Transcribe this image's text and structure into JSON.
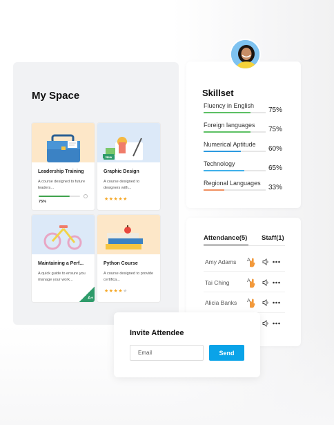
{
  "my_space": {
    "title": "My Space",
    "courses": [
      {
        "title": "Leadership Training",
        "desc": "A course designed to future leaders...",
        "progress_label": "75%",
        "progress": 0.75
      },
      {
        "title": "Graphic Design",
        "desc": "A course designed to designers with...",
        "rating": 4.5,
        "badge": "New"
      },
      {
        "title": "Maintaining a Perf...",
        "desc": "A quick guide to ensure you manage your work...",
        "badge": "A+"
      },
      {
        "title": "Python Course",
        "desc": "A course designed to provide certifica...",
        "rating": 4
      }
    ]
  },
  "skillset": {
    "title": "Skillset",
    "items": [
      {
        "name": "Fluency in English",
        "pct": "75%",
        "value": 0.75,
        "color": "#5cc063"
      },
      {
        "name": "Foreign languages",
        "pct": "75%",
        "value": 0.75,
        "color": "#5cc063"
      },
      {
        "name": "Numerical Aptitude",
        "pct": "60%",
        "value": 0.6,
        "color": "#2d9be0"
      },
      {
        "name": "Technology",
        "pct": "65%",
        "value": 0.65,
        "color": "#3fb0ea"
      },
      {
        "name": "Regional Languages",
        "pct": "33%",
        "value": 0.33,
        "color": "#f09060"
      }
    ]
  },
  "attendance": {
    "tab_attendance": "Attendance(5)",
    "tab_staff": "Staff(1)",
    "rows": [
      {
        "name": "Amy Adams"
      },
      {
        "name": "Tai Ching"
      },
      {
        "name": "Alicia Banks"
      },
      {
        "name": ""
      }
    ]
  },
  "invite": {
    "title": "Invite Attendee",
    "email_placeholder": "Email",
    "send_label": "Send"
  },
  "colors": {
    "accent": "#0aa3e8",
    "panel_bg": "#f1f2f4"
  }
}
